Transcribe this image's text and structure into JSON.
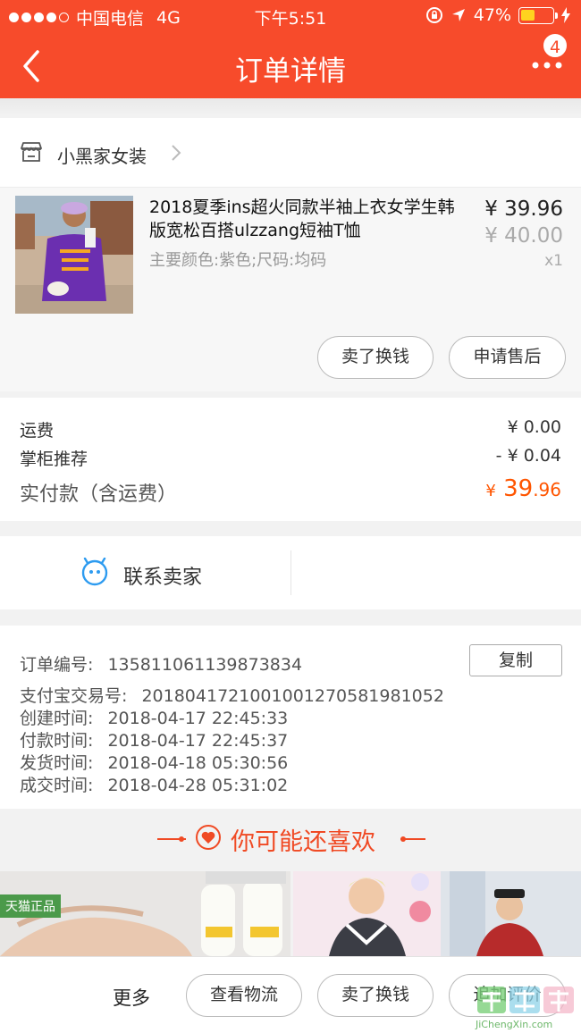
{
  "status_bar": {
    "carrier": "中国电信",
    "network": "4G",
    "time": "下午5:51",
    "battery": "47%"
  },
  "nav": {
    "title": "订单详情",
    "badge_count": "4"
  },
  "shop": {
    "name": "小黑家女装"
  },
  "product": {
    "title": "2018夏季ins超火同款半袖上衣女学生韩版宽松百搭ulzzang短袖T恤",
    "spec": "主要颜色:紫色;尺码:均码",
    "price": "¥ 39.96",
    "original_price": "¥ 40.00",
    "quantity": "x1",
    "actions": [
      "卖了换钱",
      "申请售后"
    ]
  },
  "fees": {
    "shipping_label": "运费",
    "shipping_value": "¥ 0.00",
    "discount_label": "掌柜推荐",
    "discount_value": "- ¥ 0.04",
    "total_label": "实付款（含运费）",
    "total_yen": "¥",
    "total_int": " 39",
    "total_dec": ".96"
  },
  "contact": {
    "label": "联系卖家"
  },
  "order_info": {
    "order_no_label": "订单编号:",
    "order_no": "135811061139873834",
    "copy_label": "复制",
    "alipay_label": "支付宝交易号:",
    "alipay_no": "2018041721001001270581981052",
    "created_label": "创建时间:",
    "created": "2018-04-17 22:45:33",
    "paid_label": "付款时间:",
    "paid": "2018-04-17 22:45:37",
    "shipped_label": "发货时间:",
    "shipped": "2018-04-18 05:30:56",
    "closed_label": "成交时间:",
    "closed": "2018-04-28 05:31:02"
  },
  "recommend": {
    "title": "你可能还喜欢",
    "tmall_tag": "天猫正品"
  },
  "bottom": {
    "more": "更多",
    "buttons": [
      "查看物流",
      "卖了换钱",
      "追加评价"
    ]
  },
  "watermark": {
    "text": "JiChengXin.com"
  },
  "colors": {
    "brand": "#f74b2b",
    "price_accent": "#ff5500"
  }
}
